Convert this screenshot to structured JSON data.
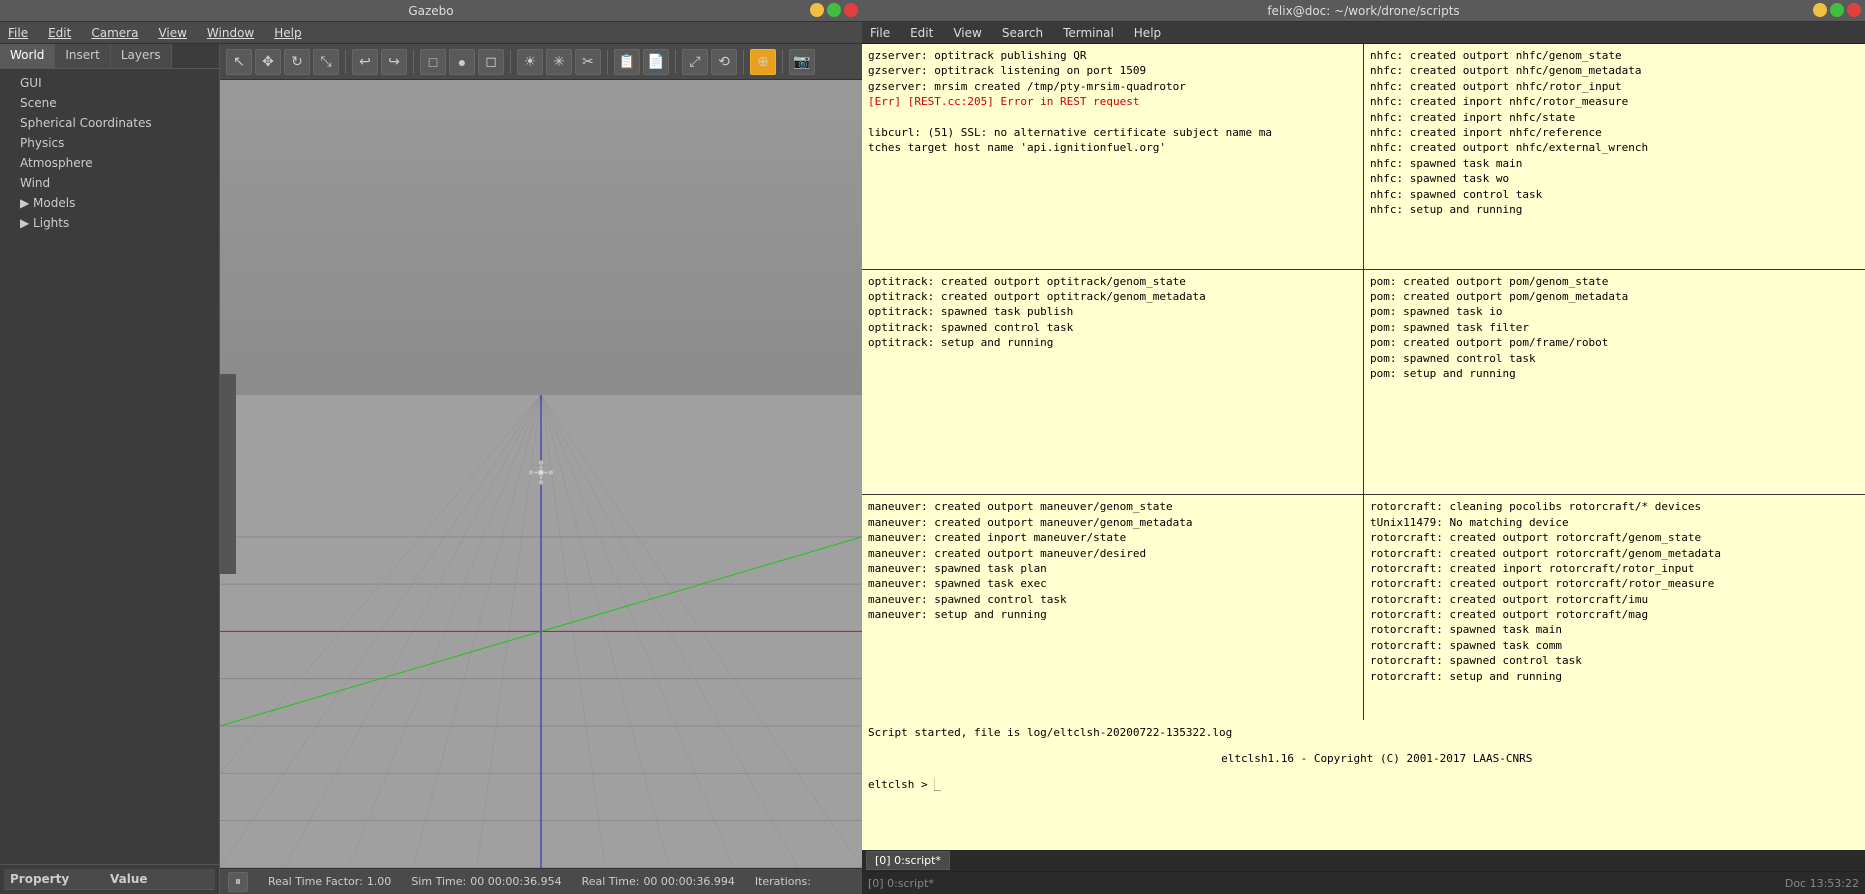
{
  "gazebo": {
    "title": "Gazebo",
    "window_controls": {
      "minimize": "–",
      "maximize": "□",
      "close": "×"
    },
    "menu": {
      "items": [
        {
          "label": "File",
          "underline": true
        },
        {
          "label": "Edit",
          "underline": true
        },
        {
          "label": "Camera",
          "underline": true
        },
        {
          "label": "View",
          "underline": true
        },
        {
          "label": "Window",
          "underline": true
        },
        {
          "label": "Help",
          "underline": true
        }
      ]
    },
    "tabs": [
      {
        "label": "World",
        "active": true
      },
      {
        "label": "Insert"
      },
      {
        "label": "Layers"
      }
    ],
    "tree": {
      "items": [
        {
          "label": "GUI",
          "indent": 1
        },
        {
          "label": "Scene",
          "indent": 1
        },
        {
          "label": "Spherical Coordinates",
          "indent": 1
        },
        {
          "label": "Physics",
          "indent": 1
        },
        {
          "label": "Atmosphere",
          "indent": 1
        },
        {
          "label": "Wind",
          "indent": 1
        },
        {
          "label": "▶ Models",
          "indent": 1,
          "arrow": true
        },
        {
          "label": "▶ Lights",
          "indent": 1,
          "arrow": true
        }
      ]
    },
    "property_panel": {
      "col1": "Property",
      "col2": "Value"
    },
    "toolbar": {
      "tools": [
        {
          "icon": "↖",
          "name": "select",
          "active": false
        },
        {
          "icon": "✥",
          "name": "move",
          "active": false
        },
        {
          "icon": "↻",
          "name": "rotate",
          "active": false
        },
        {
          "icon": "⤡",
          "name": "scale",
          "active": false
        },
        {
          "icon": "↩",
          "name": "undo",
          "active": false
        },
        {
          "icon": "→",
          "name": "sep1",
          "type": "sep"
        },
        {
          "icon": "↪",
          "name": "redo",
          "active": false
        },
        {
          "icon": "□",
          "name": "box",
          "active": false
        },
        {
          "icon": "●",
          "name": "sphere",
          "active": false
        },
        {
          "icon": "◻",
          "name": "cylinder",
          "active": false
        },
        {
          "icon": "☀",
          "name": "light-point",
          "active": false
        },
        {
          "icon": "✳",
          "name": "light-spot",
          "active": false
        },
        {
          "icon": "✂",
          "name": "light-dir",
          "active": false
        },
        {
          "icon": "→",
          "name": "sep2",
          "type": "sep"
        },
        {
          "icon": "📋",
          "name": "copy",
          "active": false
        },
        {
          "icon": "📄",
          "name": "paste",
          "active": false
        },
        {
          "icon": "→",
          "name": "sep3",
          "type": "sep"
        },
        {
          "icon": "⤢",
          "name": "align-left",
          "active": false
        },
        {
          "icon": "⟲",
          "name": "align-right",
          "active": false
        },
        {
          "icon": "⊕",
          "name": "snap",
          "active": true
        },
        {
          "icon": "📷",
          "name": "screenshot",
          "active": false
        }
      ]
    },
    "status_bar": {
      "real_time_label": "Real Time Factor:",
      "real_time_value": "1.00",
      "sim_time_label": "Sim Time:",
      "sim_time_value": "00 00:00:36.954",
      "real_time2_label": "Real Time:",
      "real_time2_value": "00 00:00:36.994",
      "iterations_label": "Iterations:"
    }
  },
  "terminal": {
    "title": "felix@doc: ~/work/drone/scripts",
    "window_controls": {
      "minimize": "–",
      "maximize": "□",
      "close": "×"
    },
    "menu": {
      "items": [
        {
          "label": "File"
        },
        {
          "label": "Edit"
        },
        {
          "label": "View"
        },
        {
          "label": "Search"
        },
        {
          "label": "Terminal"
        },
        {
          "label": "Help"
        }
      ]
    },
    "panes": [
      {
        "lines": [
          "gzserver: optitrack publishing QR",
          "gzserver: optitrack listening on port 1509",
          "gzserver: mrsim created /tmp/pty-mrsim-quadrotor",
          "[Err] [REST.cc:205] Error in REST request",
          "",
          "libcurl: (51) SSL: no alternative certificate subject name ma",
          "tches target host name 'api.ignitionfuel.org'"
        ],
        "error_lines": [
          3
        ]
      },
      {
        "lines": [
          "nhfc: created outport nhfc/genom_state",
          "nhfc: created outport nhfc/genom_metadata",
          "nhfc: created outport nhfc/rotor_input",
          "nhfc: created inport nhfc/rotor_measure",
          "nhfc: created inport nhfc/state",
          "nhfc: created inport nhfc/reference",
          "nhfc: created outport nhfc/external_wrench",
          "nhfc: spawned task main",
          "nhfc: spawned task wo",
          "nhfc: spawned control task",
          "nhfc: setup and running"
        ],
        "error_lines": []
      },
      {
        "lines": [
          "optitrack: created outport optitrack/genom_state",
          "optitrack: created outport optitrack/genom_metadata",
          "optitrack: spawned task publish",
          "optitrack: spawned control task",
          "optitrack: setup and running"
        ],
        "error_lines": []
      },
      {
        "lines": [
          "pom: created outport pom/genom_state",
          "pom: created outport pom/genom_metadata",
          "pom: spawned task io",
          "pom: spawned task filter",
          "pom: created outport pom/frame/robot",
          "pom: spawned control task",
          "pom: setup and running"
        ],
        "error_lines": []
      },
      {
        "lines": [
          "maneuver: created outport maneuver/genom_state",
          "maneuver: created outport maneuver/genom_metadata",
          "maneuver: created inport maneuver/state",
          "maneuver: created outport maneuver/desired",
          "maneuver: spawned task plan",
          "maneuver: spawned task exec",
          "maneuver: spawned control task",
          "maneuver: setup and running"
        ],
        "error_lines": []
      },
      {
        "lines": [
          "rotorcraft: cleaning pocolibs rotorcraft/* devices",
          "tUnix11479: No matching device",
          "rotorcraft: created outport rotorcraft/genom_state",
          "rotorcraft: created outport rotorcraft/genom_metadata",
          "rotorcraft: created inport rotorcraft/rotor_input",
          "rotorcraft: created outport rotorcraft/rotor_measure",
          "rotorcraft: created outport rotorcraft/imu",
          "rotorcraft: created outport rotorcraft/mag",
          "rotorcraft: spawned task main",
          "rotorcraft: spawned task comm",
          "rotorcraft: spawned control task",
          "rotorcraft: setup and running"
        ],
        "error_lines": []
      }
    ],
    "bottom_section": {
      "lines": [
        "Script started, file is log/eltclsh-20200722-135322.log",
        "",
        "    eltclsh1.16 - Copyright (C) 2001-2017  LAAS-CNRS",
        "",
        "eltclsh > █"
      ]
    },
    "tab_bar": {
      "items": [
        {
          "label": "[0] 0:script*",
          "active": true
        }
      ]
    },
    "status_bar": {
      "left": "[0] 0:script*",
      "right": "Doc  13:53:22"
    }
  }
}
